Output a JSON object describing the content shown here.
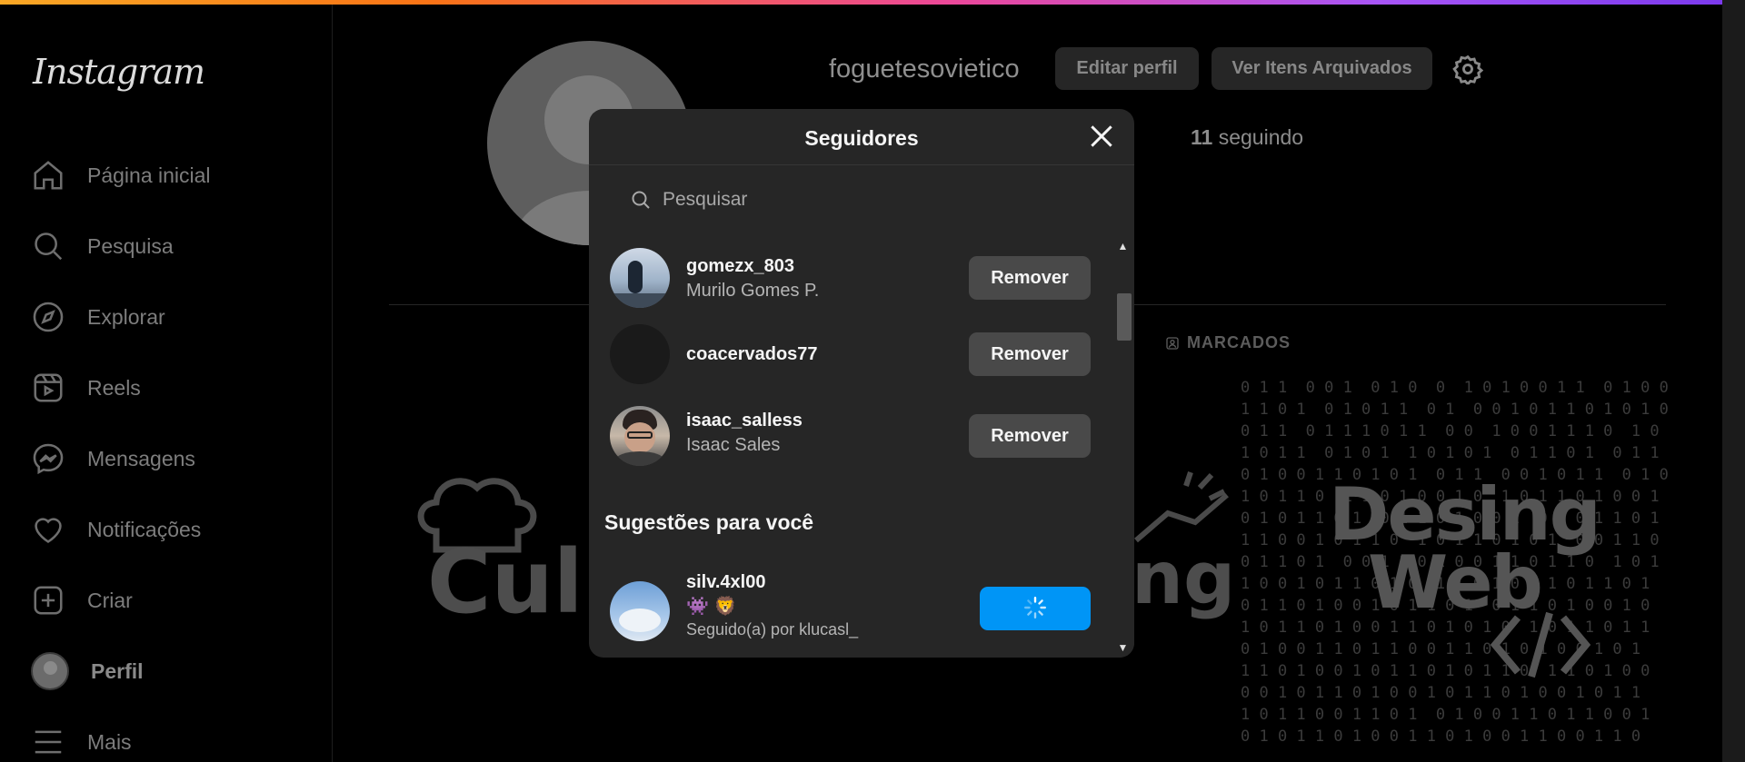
{
  "app": {
    "logo": "Instagram"
  },
  "sidebar": {
    "items": [
      {
        "label": "Página inicial",
        "icon": "home-icon"
      },
      {
        "label": "Pesquisa",
        "icon": "search-icon"
      },
      {
        "label": "Explorar",
        "icon": "compass-icon"
      },
      {
        "label": "Reels",
        "icon": "reels-icon"
      },
      {
        "label": "Mensagens",
        "icon": "messenger-icon"
      },
      {
        "label": "Notificações",
        "icon": "heart-icon"
      },
      {
        "label": "Criar",
        "icon": "plus-square-icon"
      },
      {
        "label": "Perfil",
        "icon": "avatar"
      },
      {
        "label": "Mais",
        "icon": "menu-icon"
      }
    ]
  },
  "profile": {
    "username": "foguetesovietico",
    "edit_label": "Editar perfil",
    "archive_label": "Ver Itens Arquivados",
    "following_hint": "s",
    "following_count": "11",
    "following_label": "seguindo",
    "tab_tagged": "MARCADOS",
    "posts": {
      "culinary_text": "Culi",
      "marketing_text": "ng",
      "design_line1": "Desing",
      "design_line2": "Web"
    }
  },
  "modal": {
    "title": "Seguidores",
    "search_placeholder": "Pesquisar",
    "followers": [
      {
        "username": "gomezx_803",
        "name": "Murilo Gomes P.",
        "button": "Remover"
      },
      {
        "username": "coacervados77",
        "name": "",
        "button": "Remover"
      },
      {
        "username": "isaac_salless",
        "name": "Isaac Sales",
        "button": "Remover"
      }
    ],
    "suggestions_title": "Sugestões para você",
    "suggestions": [
      {
        "username": "silv.4xl00",
        "emoji": "👾 🦁",
        "followed_by": "Seguido(a) por klucasl_"
      }
    ]
  },
  "colors": {
    "accent": "#0095f6",
    "modal_bg": "#262626",
    "button_bg": "#494949"
  }
}
